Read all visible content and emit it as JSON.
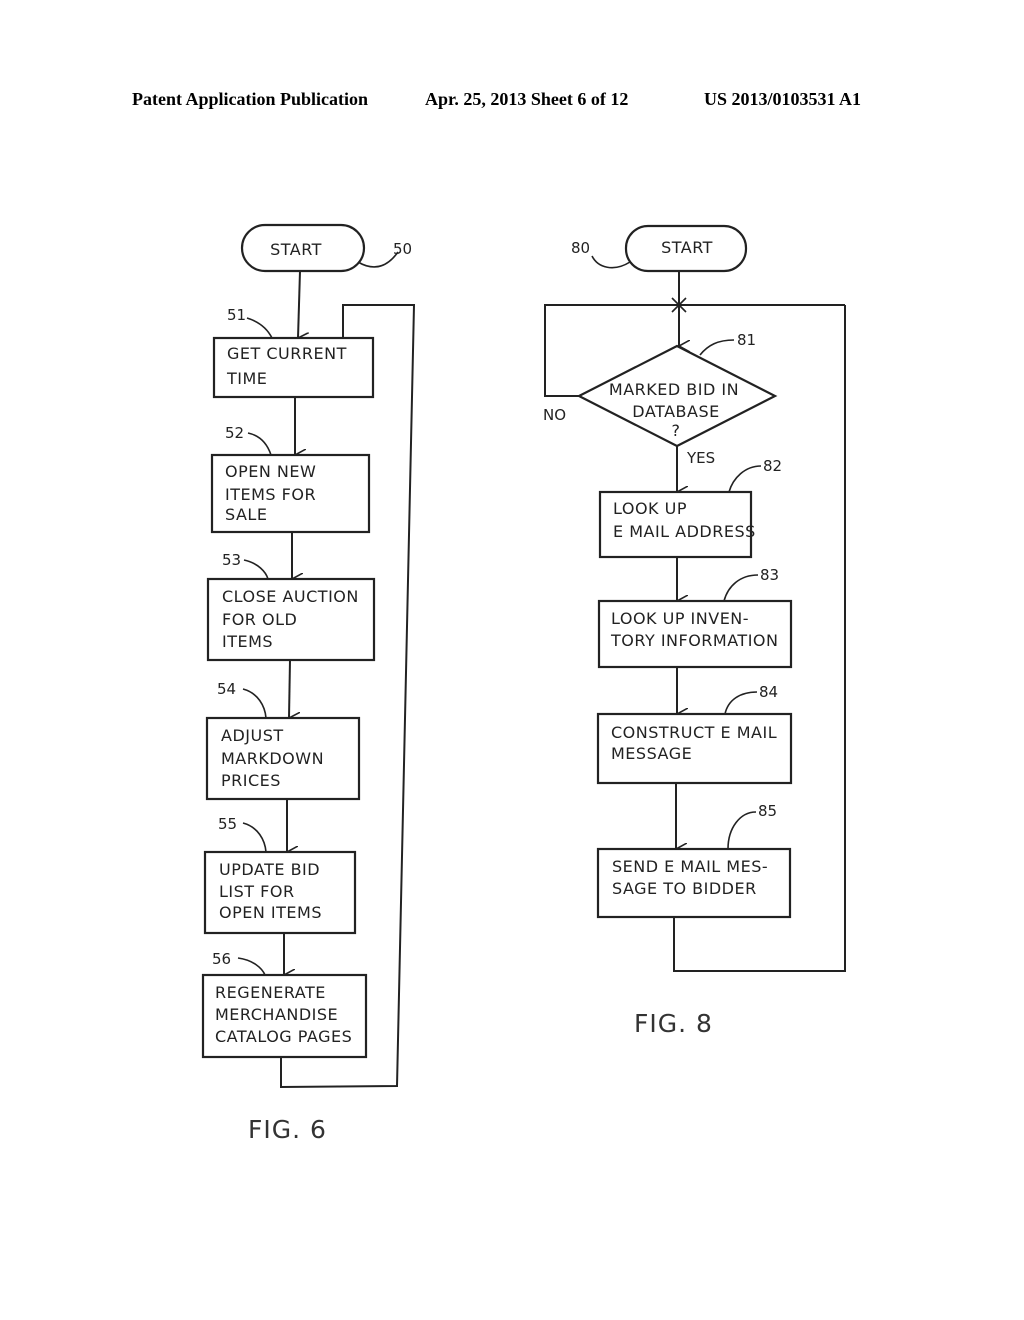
{
  "header": {
    "publication": "Patent Application Publication",
    "date_sheet": "Apr. 25, 2013  Sheet 6 of 12",
    "patent_number": "US 2013/0103531 A1"
  },
  "fig6": {
    "caption": "FIG. 6",
    "start": {
      "label": "START",
      "ref": "50"
    },
    "steps": [
      {
        "ref": "51",
        "lines": [
          "GET CURRENT",
          "TIME"
        ]
      },
      {
        "ref": "52",
        "lines": [
          "OPEN NEW",
          "ITEMS FOR",
          "SALE"
        ]
      },
      {
        "ref": "53",
        "lines": [
          "CLOSE AUCTION",
          "FOR OLD",
          "ITEMS"
        ]
      },
      {
        "ref": "54",
        "lines": [
          "ADJUST",
          "MARKDOWN",
          "PRICES"
        ]
      },
      {
        "ref": "55",
        "lines": [
          "UPDATE BID",
          "LIST FOR",
          "OPEN ITEMS"
        ]
      },
      {
        "ref": "56",
        "lines": [
          "REGENERATE",
          "MERCHANDISE",
          "CATALOG PAGES"
        ]
      }
    ]
  },
  "fig8": {
    "caption": "FIG. 8",
    "start": {
      "label": "START",
      "ref": "80"
    },
    "decision": {
      "ref": "81",
      "lines": [
        "MARKED BID IN",
        "DATABASE",
        "?"
      ],
      "no_label": "NO",
      "yes_label": "YES"
    },
    "steps": [
      {
        "ref": "82",
        "lines": [
          "LOOK UP",
          "E MAIL ADDRESS"
        ]
      },
      {
        "ref": "83",
        "lines": [
          "LOOK UP INVEN-",
          "TORY INFORMATION"
        ]
      },
      {
        "ref": "84",
        "lines": [
          "CONSTRUCT E MAIL",
          "MESSAGE"
        ]
      },
      {
        "ref": "85",
        "lines": [
          "SEND E MAIL MES-",
          "SAGE TO BIDDER"
        ]
      }
    ]
  }
}
